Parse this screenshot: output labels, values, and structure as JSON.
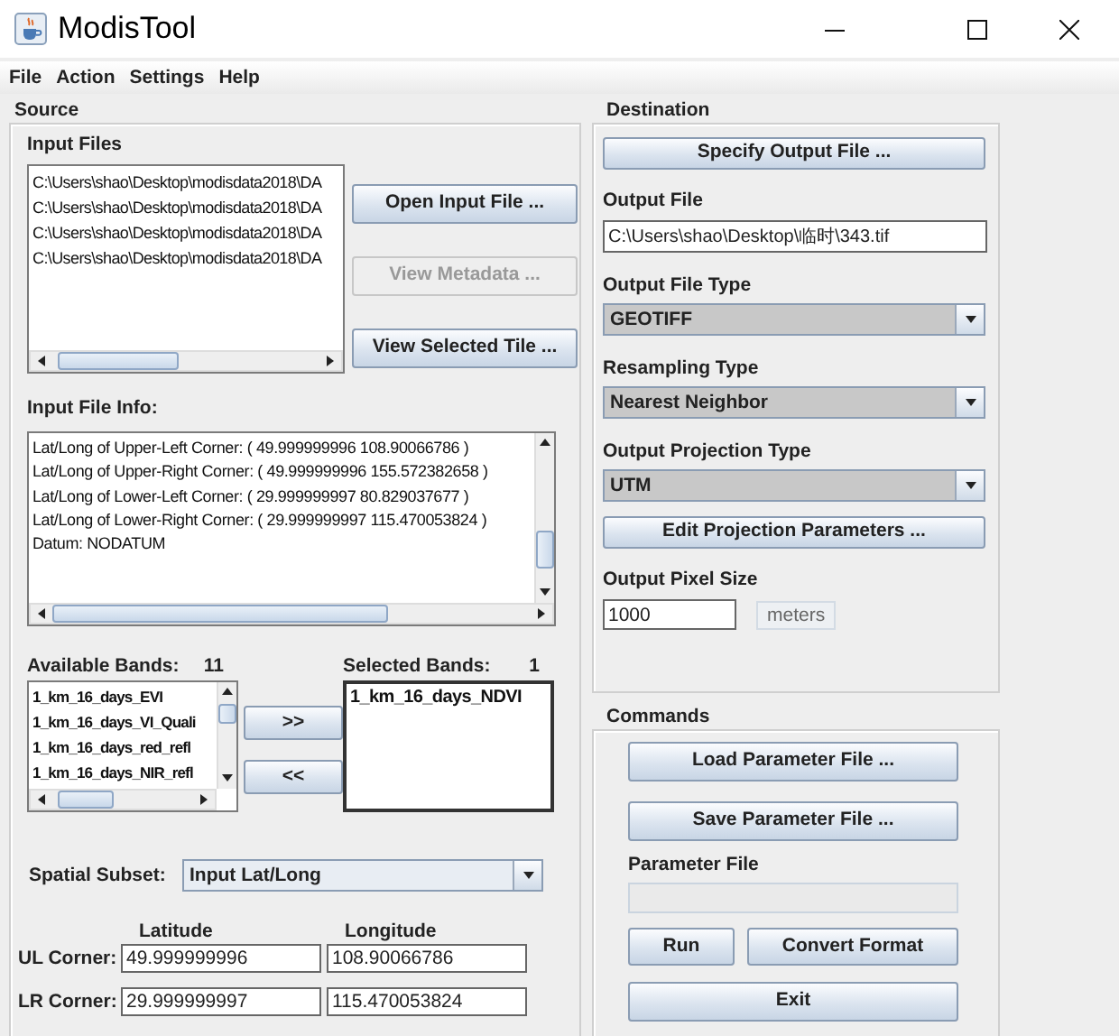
{
  "window": {
    "title": "ModisTool"
  },
  "menu": [
    "File",
    "Action",
    "Settings",
    "Help"
  ],
  "source": {
    "title": "Source",
    "input_files": {
      "label": "Input Files",
      "items": [
        "C:\\Users\\shao\\Desktop\\modisdata2018\\DA",
        "C:\\Users\\shao\\Desktop\\modisdata2018\\DA",
        "C:\\Users\\shao\\Desktop\\modisdata2018\\DA",
        "C:\\Users\\shao\\Desktop\\modisdata2018\\DA"
      ]
    },
    "file_buttons": [
      {
        "label": "Open Input File ...",
        "disabled": false
      },
      {
        "label": "View Metadata ...",
        "disabled": true
      },
      {
        "label": "View Selected Tile  ...",
        "disabled": false
      }
    ],
    "file_info": {
      "label": "Input File Info:",
      "lines": [
        "Lat/Long of Upper-Left Corner: ( 49.999999996 108.90066786 )",
        "Lat/Long of Upper-Right Corner: ( 49.999999996 155.572382658 )",
        "Lat/Long of Lower-Left Corner: ( 29.999999997 80.829037677 )",
        "Lat/Long of Lower-Right Corner: ( 29.999999997 115.470053824 )",
        "Datum: NODATUM"
      ]
    },
    "available_bands": {
      "label": "Available Bands:",
      "count": "11",
      "items": [
        "1_km_16_days_EVI",
        "1_km_16_days_VI_Quali",
        "1_km_16_days_red_refl",
        "1_km_16_days_NIR_refl"
      ]
    },
    "move_buttons": [
      ">>",
      "<<"
    ],
    "selected_bands": {
      "label": "Selected Bands:",
      "count": "1",
      "items": [
        "1_km_16_days_NDVI"
      ]
    },
    "spatial_subset": {
      "label": "Spatial Subset:",
      "value": "Input Lat/Long"
    },
    "corners": {
      "columns": [
        "Latitude",
        "Longitude"
      ],
      "rows": [
        {
          "label": "UL Corner:",
          "latitude": "49.999999996",
          "longitude": "108.90066786"
        },
        {
          "label": "LR Corner:",
          "latitude": "29.999999997",
          "longitude": "115.470053824"
        }
      ]
    }
  },
  "destination": {
    "title": "Destination",
    "specify_button": "Specify Output File ...",
    "output_file": {
      "label": "Output File",
      "value": "C:\\Users\\shao\\Desktop\\临时\\343.tif"
    },
    "selects": [
      {
        "label": "Output File Type",
        "value": "GEOTIFF"
      },
      {
        "label": "Resampling Type",
        "value": "Nearest Neighbor"
      },
      {
        "label": "Output Projection Type",
        "value": "UTM"
      }
    ],
    "edit_button": "Edit Projection Parameters ...",
    "pixel_size": {
      "label": "Output Pixel Size",
      "value": "1000",
      "unit": "meters"
    }
  },
  "commands": {
    "title": "Commands",
    "load_button": "Load Parameter File ...",
    "save_button": "Save Parameter File ...",
    "parameter_file": {
      "label": "Parameter File",
      "disabled": true
    },
    "run_button": "Run",
    "convert_button": "Convert Format",
    "exit_button": "Exit"
  }
}
